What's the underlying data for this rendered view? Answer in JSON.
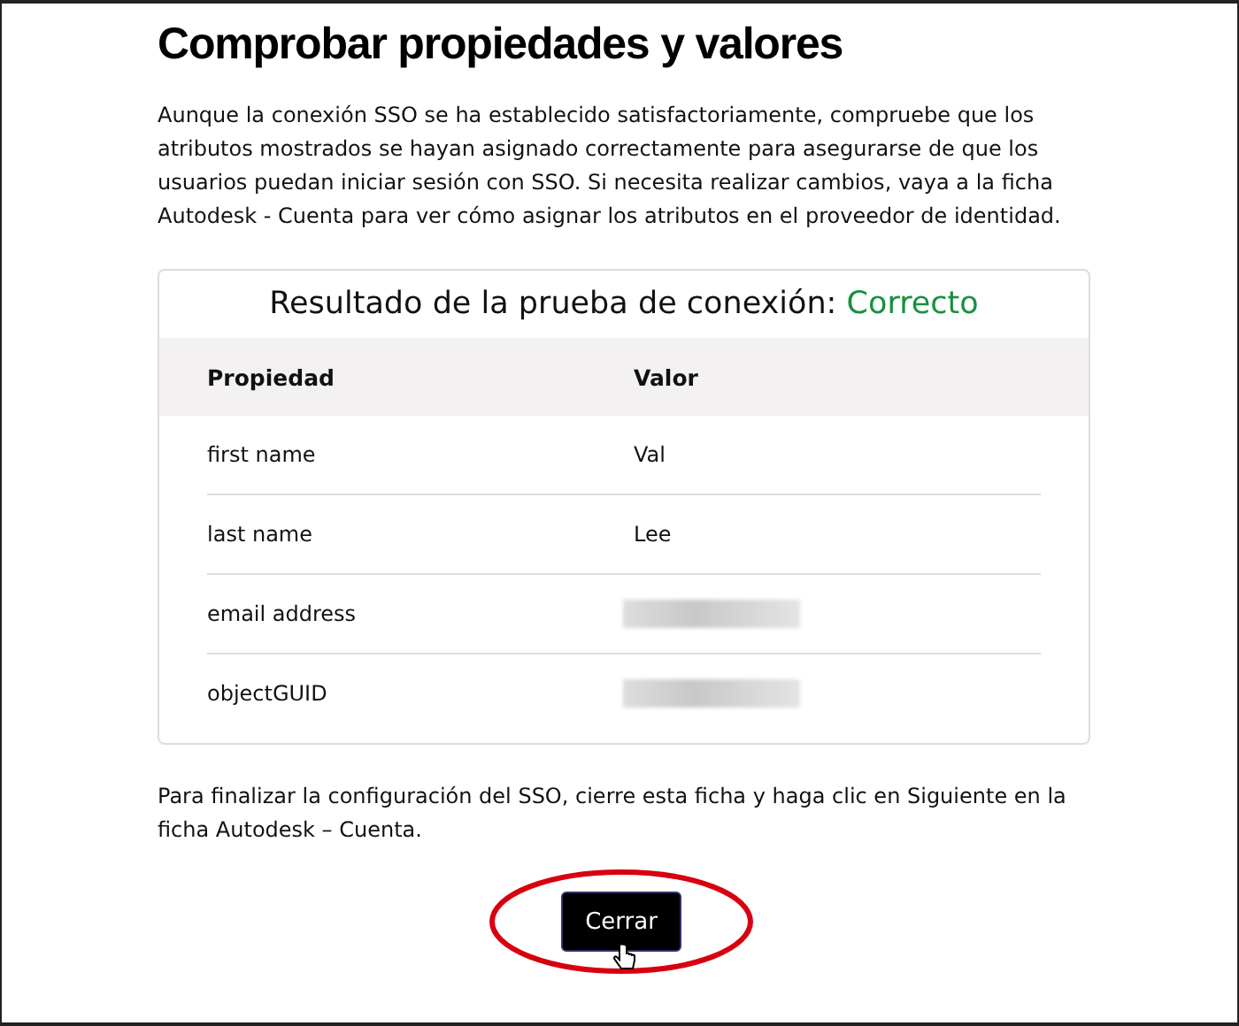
{
  "heading": "Comprobar propiedades y valores",
  "intro": "Aunque la conexión SSO se ha establecido satisfactoriamente, compruebe que los atributos mostrados se hayan asignado correctamente para asegurarse de que los usuarios puedan iniciar sesión con SSO. Si necesita realizar cambios, vaya a la ficha Autodesk - Cuenta para ver cómo asignar los atributos en el proveedor de identidad.",
  "result": {
    "label": "Resultado de la prueba de conexión:",
    "status": "Correcto",
    "color": "#16913f"
  },
  "table": {
    "columns": [
      "Propiedad",
      "Valor"
    ],
    "rows": [
      {
        "property": "first name",
        "value": "Val",
        "redacted": false
      },
      {
        "property": "last name",
        "value": "Lee",
        "redacted": false
      },
      {
        "property": "email address",
        "redacted": true
      },
      {
        "property": "objectGUID",
        "redacted": true
      }
    ]
  },
  "footer": "Para finalizar la configuración del SSO, cierre esta ficha y haga clic en Siguiente en la ficha Autodesk – Cuenta.",
  "button": {
    "label": "Cerrar",
    "highlighted": true
  }
}
